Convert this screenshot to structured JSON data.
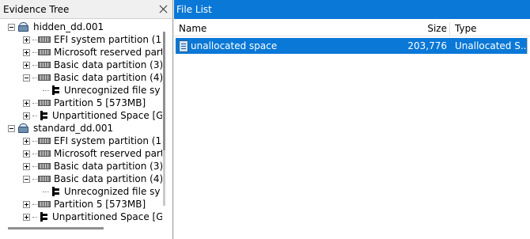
{
  "evidence_tree": {
    "title": "Evidence Tree",
    "images": [
      {
        "label": "hidden_dd.001",
        "children": [
          {
            "label": "EFI system partition (1)",
            "expander": "plus"
          },
          {
            "label": "Microsoft reserved partit",
            "expander": "plus"
          },
          {
            "label": "Basic data partition (3) [",
            "expander": "plus"
          },
          {
            "label": "Basic data partition (4) [",
            "expander": "minus",
            "children": [
              {
                "label": "Unrecognized file sy"
              }
            ]
          },
          {
            "label": "Partition 5 [573MB]",
            "expander": "plus"
          },
          {
            "label": "Unpartitioned Space [GF",
            "expander": "plus"
          }
        ]
      },
      {
        "label": "standard_dd.001",
        "children": [
          {
            "label": "EFI system partition (1)",
            "expander": "plus"
          },
          {
            "label": "Microsoft reserved partit",
            "expander": "plus"
          },
          {
            "label": "Basic data partition (3) [",
            "expander": "plus"
          },
          {
            "label": "Basic data partition (4) [",
            "expander": "minus",
            "children": [
              {
                "label": "Unrecognized file sy"
              }
            ]
          },
          {
            "label": "Partition 5 [573MB]",
            "expander": "plus"
          },
          {
            "label": "Unpartitioned Space [GF",
            "expander": "plus"
          }
        ]
      }
    ]
  },
  "file_list": {
    "title": "File List",
    "columns": {
      "name": "Name",
      "size": "Size",
      "type": "Type"
    },
    "rows": [
      {
        "name": "unallocated space",
        "size": "203,776",
        "type": "Unallocated S..."
      }
    ]
  },
  "colors": {
    "accent": "#0a78d7"
  }
}
